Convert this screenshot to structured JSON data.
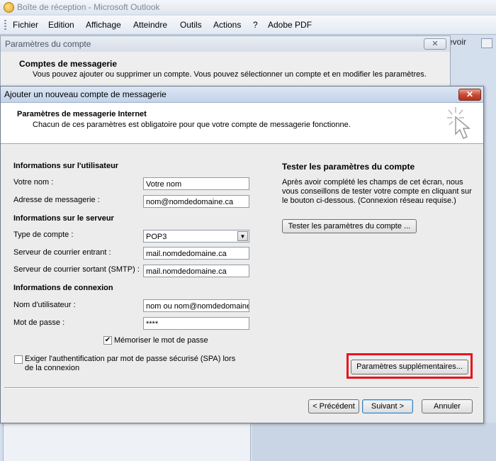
{
  "outlook": {
    "title": "Boîte de réception - Microsoft Outlook",
    "menu": [
      "Fichier",
      "Edition",
      "Affichage",
      "Atteindre",
      "Outils",
      "Actions",
      "?",
      "Adobe PDF"
    ],
    "right_fragment": "evoir"
  },
  "account_window": {
    "title": "Paramètres du compte",
    "heading": "Comptes de messagerie",
    "subtitle": "Vous pouvez ajouter ou supprimer un compte. Vous pouvez sélectionner un compte et en modifier les paramètres."
  },
  "dialog": {
    "title": "Ajouter un nouveau compte de messagerie",
    "close": "✕",
    "header_title": "Paramètres de messagerie Internet",
    "header_subtitle": "Chacun de ces paramètres est obligatoire pour que votre compte de messagerie fonctionne.",
    "user_section": "Informations sur l'utilisateur",
    "name_label": "Votre nom :",
    "name_value": "Votre nom",
    "email_label": "Adresse de messagerie :",
    "email_value": "nom@nomdedomaine.ca",
    "server_section": "Informations sur le serveur",
    "account_type_label": "Type de compte :",
    "account_type_value": "POP3",
    "incoming_label": "Serveur de courrier entrant :",
    "incoming_value": "mail.nomdedomaine.ca",
    "outgoing_label": "Serveur de courrier sortant (SMTP) :",
    "outgoing_value": "mail.nomdedomaine.ca",
    "login_section": "Informations de connexion",
    "username_label": "Nom d'utilisateur :",
    "username_value": "nom ou nom@nomdedomaine.ca",
    "password_label": "Mot de passe :",
    "password_value": "****",
    "remember_label": "Mémoriser le mot de passe",
    "remember_checked": true,
    "spa_label_1": "Exiger l'authentification par mot de passe sécurisé (SPA) lors",
    "spa_label_2": "de la connexion",
    "spa_checked": false,
    "test_section": "Tester les paramètres du compte",
    "test_text_1": "Après avoir complété les champs de cet écran, nous",
    "test_text_2": "vous conseillons de tester votre compte en cliquant sur",
    "test_text_3": "le bouton ci-dessous. (Connexion réseau requise.)",
    "test_button": "Tester les paramètres du compte ...",
    "more_settings_button": "Paramètres supplémentaires...",
    "prev_button": "< Précédent",
    "next_button": "Suivant >",
    "cancel_button": "Annuler"
  },
  "colors": {
    "highlight": "#e8141c",
    "dialog_title_bar": "#c3d3ea",
    "close_button": "#c7452e"
  }
}
